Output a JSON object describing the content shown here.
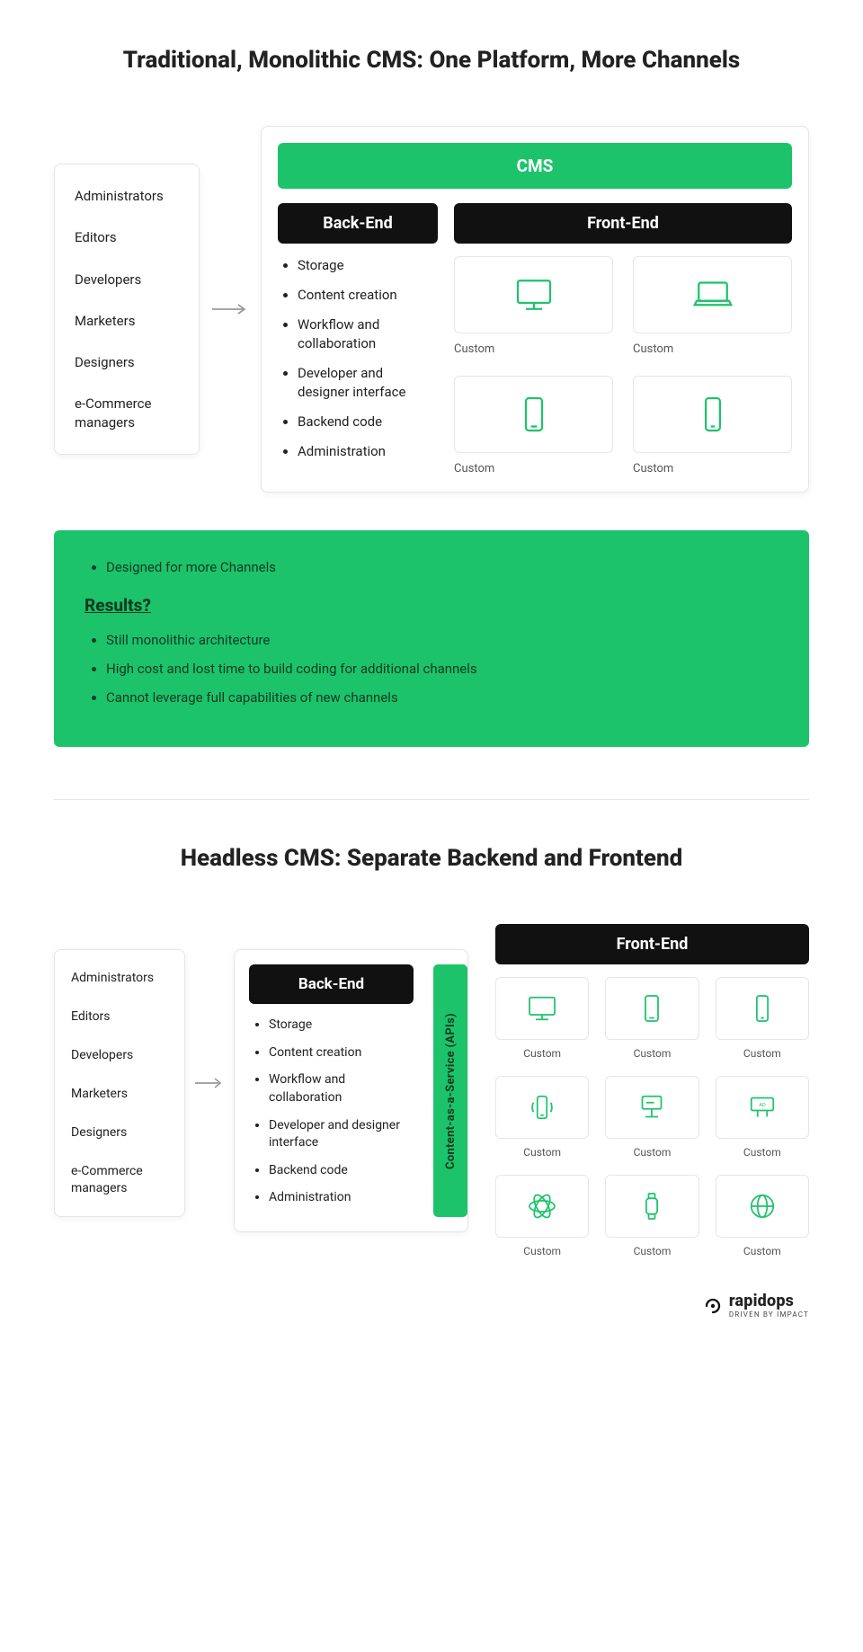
{
  "section1": {
    "title": "Traditional, Monolithic CMS: One Platform, More Channels",
    "roles": [
      "Administrators",
      "Editors",
      "Developers",
      "Marketers",
      "Designers",
      "e-Commerce managers"
    ],
    "cms_label": "CMS",
    "backend_label": "Back-End",
    "frontend_label": "Front-End",
    "backend_items": [
      "Storage",
      "Content creation",
      "Workflow and collaboration",
      "Developer and designer interface",
      "Backend code",
      "Administration"
    ],
    "frontend_tiles": [
      {
        "icon": "desktop",
        "label": "Custom"
      },
      {
        "icon": "laptop",
        "label": "Custom"
      },
      {
        "icon": "tablet",
        "label": "Custom"
      },
      {
        "icon": "phone",
        "label": "Custom"
      }
    ],
    "results_intro": [
      "Designed for more Channels"
    ],
    "results_heading": "Results?",
    "results_items": [
      "Still monolithic architecture",
      "High cost and lost time to build coding for additional channels",
      "Cannot leverage full capabilities of new channels"
    ]
  },
  "section2": {
    "title": "Headless CMS: Separate Backend and Frontend",
    "roles": [
      "Administrators",
      "Editors",
      "Developers",
      "Marketers",
      "Designers",
      "e-Commerce managers"
    ],
    "backend_label": "Back-End",
    "frontend_label": "Front-End",
    "backend_items": [
      "Storage",
      "Content creation",
      "Workflow and collaboration",
      "Developer and designer interface",
      "Backend code",
      "Administration"
    ],
    "api_label": "Content-as-a-Service (APIs)",
    "frontend_tiles": [
      {
        "icon": "desktop",
        "label": "Custom"
      },
      {
        "icon": "tablet",
        "label": "Custom"
      },
      {
        "icon": "phone",
        "label": "Custom"
      },
      {
        "icon": "phone-vibrate",
        "label": "Custom"
      },
      {
        "icon": "kiosk",
        "label": "Custom"
      },
      {
        "icon": "billboard",
        "label": "Custom"
      },
      {
        "icon": "atom",
        "label": "Custom"
      },
      {
        "icon": "watch",
        "label": "Custom"
      },
      {
        "icon": "globe",
        "label": "Custom"
      }
    ]
  },
  "logo": {
    "name": "rapidops",
    "tagline": "DRIVEN BY IMPACT"
  }
}
